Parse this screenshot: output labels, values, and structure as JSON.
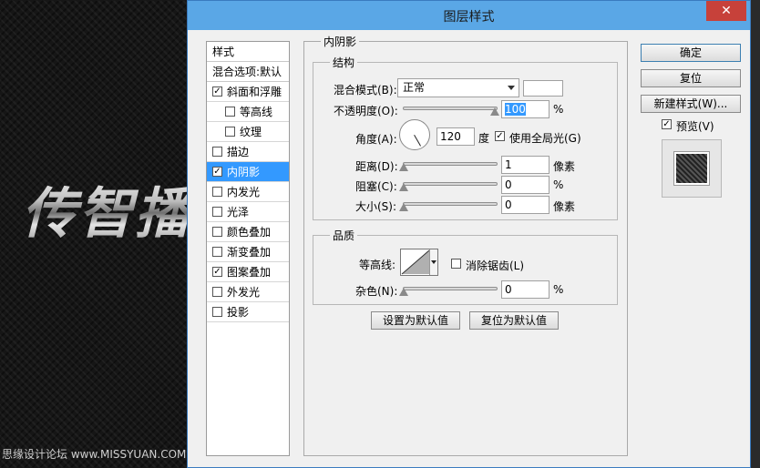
{
  "background": {
    "art_text": "传智播",
    "watermark": "思缘设计论坛 www.MISSYUAN.COM"
  },
  "dialog": {
    "title": "图层样式",
    "close_symbol": "✕"
  },
  "style_list": {
    "header": "样式",
    "blend_options": "混合选项:默认",
    "items": [
      {
        "label": "斜面和浮雕",
        "checked": true,
        "indent": false,
        "selected": false
      },
      {
        "label": "等高线",
        "checked": false,
        "indent": true,
        "selected": false
      },
      {
        "label": "纹理",
        "checked": false,
        "indent": true,
        "selected": false
      },
      {
        "label": "描边",
        "checked": false,
        "indent": false,
        "selected": false
      },
      {
        "label": "内阴影",
        "checked": true,
        "indent": false,
        "selected": true
      },
      {
        "label": "内发光",
        "checked": false,
        "indent": false,
        "selected": false
      },
      {
        "label": "光泽",
        "checked": false,
        "indent": false,
        "selected": false
      },
      {
        "label": "颜色叠加",
        "checked": false,
        "indent": false,
        "selected": false
      },
      {
        "label": "渐变叠加",
        "checked": false,
        "indent": false,
        "selected": false
      },
      {
        "label": "图案叠加",
        "checked": true,
        "indent": false,
        "selected": false
      },
      {
        "label": "外发光",
        "checked": false,
        "indent": false,
        "selected": false
      },
      {
        "label": "投影",
        "checked": false,
        "indent": false,
        "selected": false
      }
    ]
  },
  "inner_shadow": {
    "section_title": "内阴影",
    "structure": {
      "title": "结构",
      "blend_mode_label": "混合模式(B):",
      "blend_mode_value": "正常",
      "opacity_label": "不透明度(O):",
      "opacity_value": "100",
      "percent": "%",
      "angle_label": "角度(A):",
      "angle_value": "120",
      "degree_unit": "度",
      "global_light_label": "使用全局光(G)",
      "global_light_checked": true,
      "distance_label": "距离(D):",
      "distance_value": "1",
      "pixel_unit": "像素",
      "choke_label": "阻塞(C):",
      "choke_value": "0",
      "size_label": "大小(S):",
      "size_value": "0"
    },
    "quality": {
      "title": "品质",
      "contour_label": "等高线:",
      "anti_alias_label": "消除锯齿(L)",
      "anti_alias_checked": false,
      "noise_label": "杂色(N):",
      "noise_value": "0",
      "percent": "%"
    },
    "set_default": "设置为默认值",
    "reset_default": "复位为默认值"
  },
  "right_panel": {
    "ok": "确定",
    "reset": "复位",
    "new_style": "新建样式(W)...",
    "preview_label": "预览(V)",
    "preview_checked": true
  },
  "colors": {
    "titlebar": "#5aa7e6",
    "close": "#c7413a",
    "selection": "#3399ff"
  }
}
